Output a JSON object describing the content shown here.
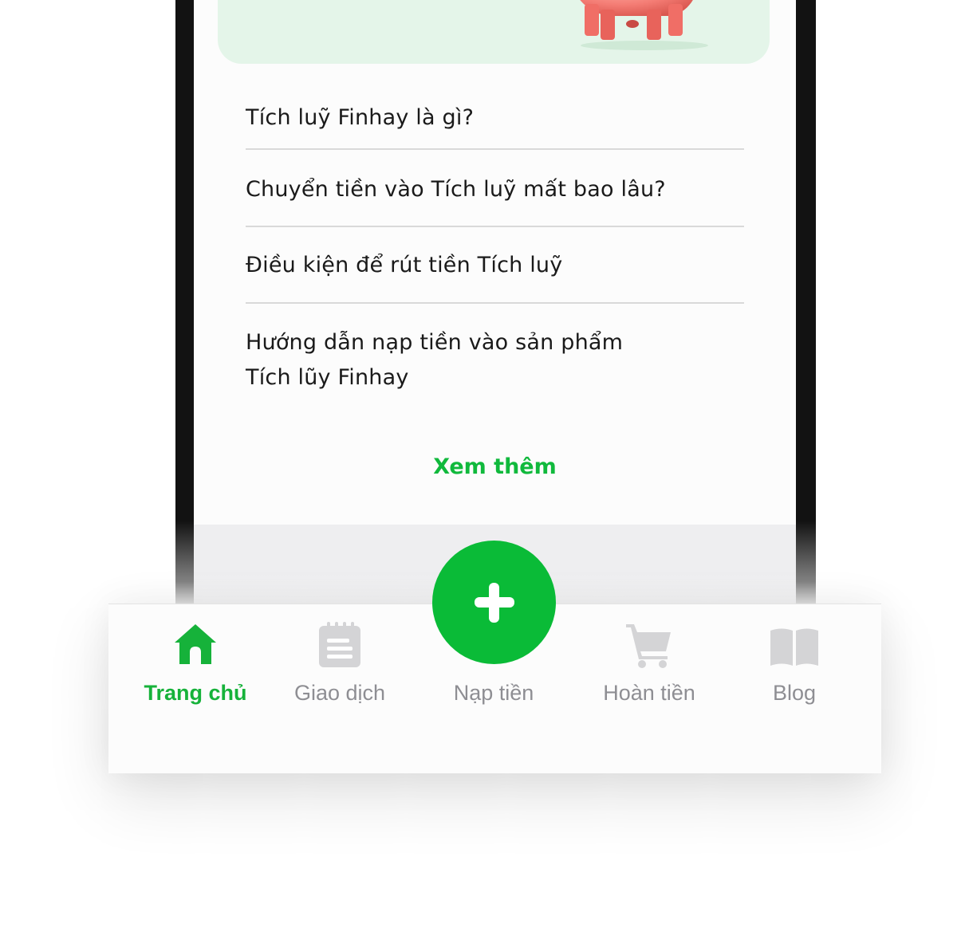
{
  "colors": {
    "accent": "#0abb37",
    "active_tab": "#16b23a",
    "inactive_tab": "#8e8e93",
    "card_bg": "#e4f5e9",
    "piggy": "#f47c74"
  },
  "faq": {
    "items": [
      {
        "lines": [
          "Tích luỹ Finhay là gì?"
        ]
      },
      {
        "lines": [
          "Chuyển tiền vào Tích luỹ mất bao lâu?"
        ]
      },
      {
        "lines": [
          "Điều kiện để rút tiền Tích luỹ"
        ]
      },
      {
        "lines": [
          "Hướng dẫn nạp tiền vào sản phẩm",
          "Tích lũy Finhay"
        ]
      }
    ],
    "see_more_label": "Xem thêm"
  },
  "promo": {
    "illustration": "piggy-bank"
  },
  "tabbar": {
    "tabs": [
      {
        "label": "Trang chủ",
        "icon": "home-icon",
        "active": true
      },
      {
        "label": "Giao dịch",
        "icon": "clipboard-icon",
        "active": false
      },
      {
        "label": "Nạp tiền",
        "icon": "plus-icon",
        "active": false
      },
      {
        "label": "Hoàn tiền",
        "icon": "cart-icon",
        "active": false
      },
      {
        "label": "Blog",
        "icon": "book-icon",
        "active": false
      }
    ]
  }
}
